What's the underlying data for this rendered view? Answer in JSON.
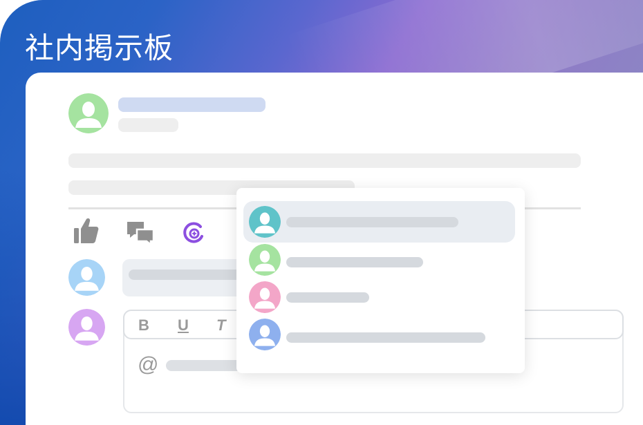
{
  "page": {
    "title": "社内掲示板"
  },
  "colors": {
    "avatar_green": "#a5e3a0",
    "avatar_blue": "#a7d4f7",
    "avatar_purple": "#d7a6f2",
    "avatar_teal": "#5fc3c9",
    "avatar_pink": "#f3a6c8",
    "avatar_periwinkle": "#8eb0ee",
    "accent_purple": "#8c4fe0",
    "skeleton_name": "#cfdaf2",
    "skeleton": "#eeeeee",
    "selected_item_bg": "#e9edf2"
  },
  "post": {
    "author_avatar_icon": "user-icon"
  },
  "actions": [
    {
      "name": "like",
      "icon": "thumbs-up-icon"
    },
    {
      "name": "comments",
      "icon": "chat-bubbles-icon"
    },
    {
      "name": "share",
      "icon": "share-icon"
    }
  ],
  "editor": {
    "toolbar": {
      "bold_label": "B",
      "underline_label": "U",
      "italic_label": "T"
    },
    "mention_symbol": "@"
  },
  "mention_dropdown": {
    "items": [
      {
        "avatar_color": "#5fc3c9",
        "selected": true
      },
      {
        "avatar_color": "#a5e3a0",
        "selected": false
      },
      {
        "avatar_color": "#f3a6c8",
        "selected": false
      },
      {
        "avatar_color": "#8eb0ee",
        "selected": false
      }
    ]
  }
}
